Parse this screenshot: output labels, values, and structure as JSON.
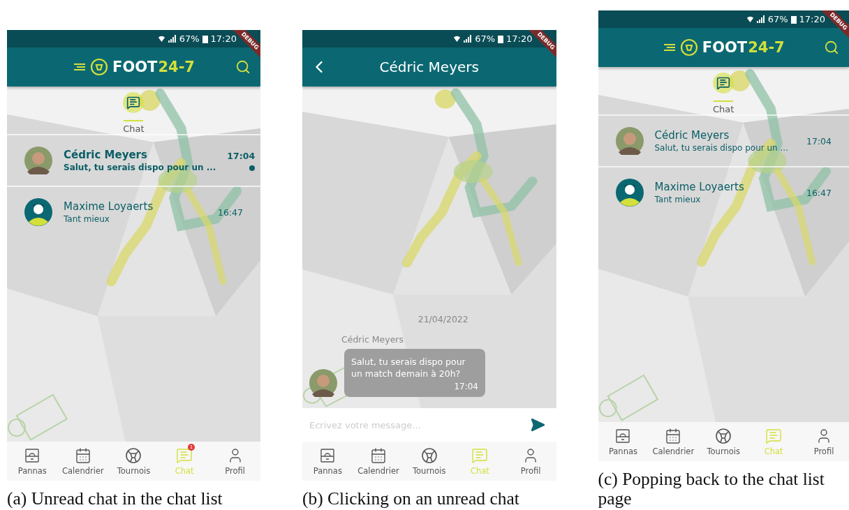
{
  "screens": [
    {
      "kind": "list",
      "status": {
        "battery": "67%",
        "time": "17:20"
      },
      "ribbon": "DEBUG",
      "header": {
        "logo_word": "FOOT",
        "logo_number": "24-7"
      },
      "section": {
        "label": "Chat"
      },
      "chats": [
        {
          "name": "Cédric Meyers",
          "preview": "Salut, tu serais dispo pour un ...",
          "time": "17:04",
          "unread": true
        },
        {
          "name": "Maxime Loyaerts",
          "preview": "Tant mieux",
          "time": "16:47",
          "unread": false,
          "avatar": {
            "kind": "silhouette"
          }
        }
      ],
      "nav": [
        {
          "label": "Pannas",
          "selected": false
        },
        {
          "label": "Calendrier",
          "selected": false
        },
        {
          "label": "Tournois",
          "selected": false
        },
        {
          "label": "Chat",
          "selected": true,
          "badge": "1"
        },
        {
          "label": "Profil",
          "selected": false
        }
      ],
      "caption": "(a) Unread chat in the chat list"
    },
    {
      "kind": "conversation",
      "status": {
        "battery": "67%",
        "time": "17:20"
      },
      "ribbon": "DEBUG",
      "header": {
        "title": "Cédric Meyers"
      },
      "date": "21/04/2022",
      "messages": [
        {
          "sender": "Cédric Meyers",
          "text": "Salut, tu serais dispo pour un match demain à 20h?",
          "time": "17:04"
        }
      ],
      "input": {
        "placeholder": "Ecrivez votre message..."
      },
      "nav": [
        {
          "label": "Pannas",
          "selected": false
        },
        {
          "label": "Calendrier",
          "selected": false
        },
        {
          "label": "Tournois",
          "selected": false
        },
        {
          "label": "Chat",
          "selected": true
        },
        {
          "label": "Profil",
          "selected": false
        }
      ],
      "caption": "(b) Clicking on an unread chat"
    },
    {
      "kind": "list",
      "status": {
        "battery": "67%",
        "time": "17:20"
      },
      "ribbon": "DEBUG",
      "header": {
        "logo_word": "FOOT",
        "logo_number": "24-7"
      },
      "section": {
        "label": "Chat"
      },
      "chats": [
        {
          "name": "Cédric Meyers",
          "preview": "Salut, tu serais dispo pour un ...",
          "time": "17:04",
          "unread": false
        },
        {
          "name": "Maxime Loyaerts",
          "preview": "Tant mieux",
          "time": "16:47",
          "unread": false,
          "avatar": {
            "kind": "silhouette"
          }
        }
      ],
      "nav": [
        {
          "label": "Pannas",
          "selected": false
        },
        {
          "label": "Calendrier",
          "selected": false
        },
        {
          "label": "Tournois",
          "selected": false
        },
        {
          "label": "Chat",
          "selected": true
        },
        {
          "label": "Profil",
          "selected": false
        }
      ],
      "caption": "(c) Popping back to the chat list page"
    }
  ]
}
